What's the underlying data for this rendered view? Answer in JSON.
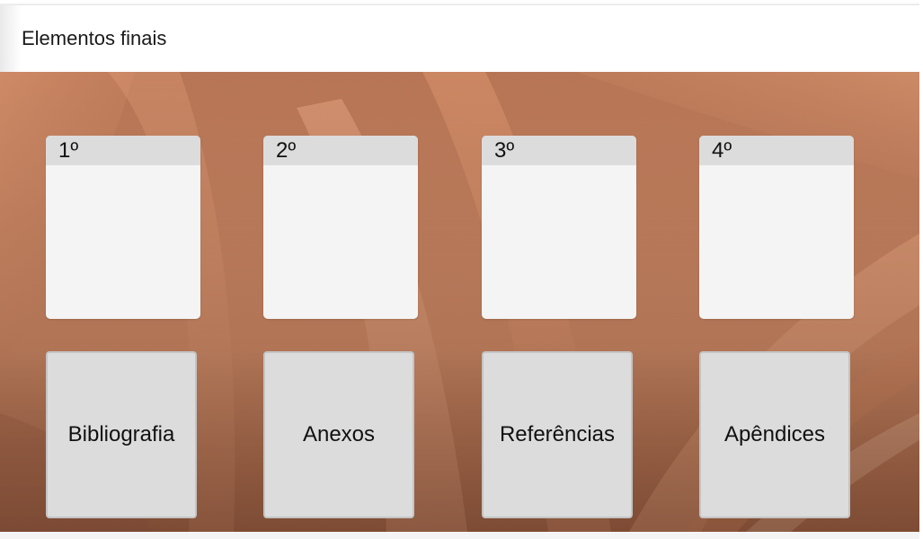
{
  "header": {
    "title": "Elementos finais"
  },
  "background": {
    "description_icon": "open-book-image",
    "tint": "#c98664"
  },
  "slots": [
    {
      "number": "1º"
    },
    {
      "number": "2º"
    },
    {
      "number": "3º"
    },
    {
      "number": "4º"
    }
  ],
  "cards": [
    {
      "label": "Bibliografia"
    },
    {
      "label": "Anexos"
    },
    {
      "label": "Referências"
    },
    {
      "label": "Apêndices"
    }
  ]
}
